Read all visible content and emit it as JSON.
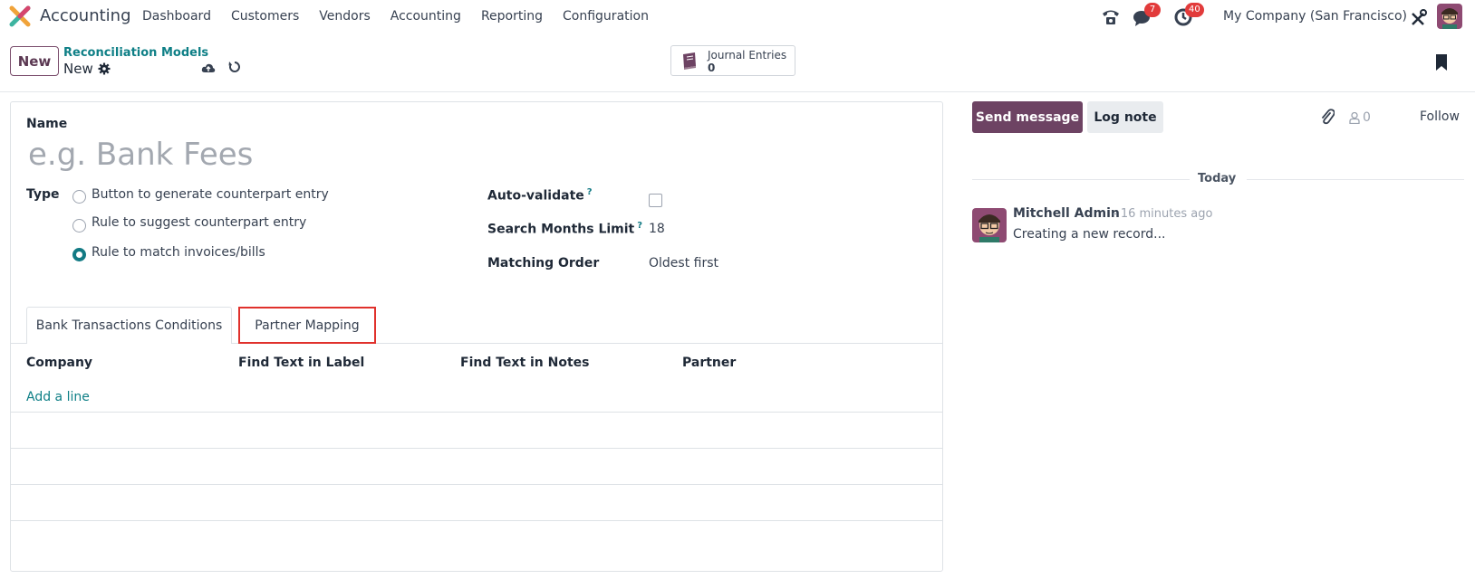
{
  "navbar": {
    "app_name": "Accounting",
    "menu": [
      "Dashboard",
      "Customers",
      "Vendors",
      "Accounting",
      "Reporting",
      "Configuration"
    ],
    "chat_badge": "7",
    "activity_badge": "40",
    "company": "My Company (San Francisco)"
  },
  "control_panel": {
    "new_label": "New",
    "breadcrumb_parent": "Reconciliation Models",
    "breadcrumb_current": "New",
    "smart_button": {
      "label": "Journal Entries",
      "value": "0"
    }
  },
  "form": {
    "name_label": "Name",
    "name_placeholder": "e.g. Bank Fees",
    "type_label": "Type",
    "type_options": [
      {
        "label": "Button to generate counterpart entry",
        "checked": false
      },
      {
        "label": "Rule to suggest counterpart entry",
        "checked": false
      },
      {
        "label": "Rule to match invoices/bills",
        "checked": true
      }
    ],
    "auto_validate_label": "Auto-validate",
    "auto_validate_checked": false,
    "search_months_label": "Search Months Limit",
    "search_months_value": "18",
    "matching_order_label": "Matching Order",
    "matching_order_value": "Oldest first",
    "help_mark": "?",
    "tabs": [
      "Bank Transactions Conditions",
      "Partner Mapping"
    ],
    "active_tab": "Partner Mapping",
    "columns": [
      "Company",
      "Find Text in Label",
      "Find Text in Notes",
      "Partner"
    ],
    "add_line_label": "Add a line"
  },
  "chatter": {
    "send_message_label": "Send message",
    "log_note_label": "Log note",
    "followers_count": "0",
    "follow_label": "Follow",
    "date_separator": "Today",
    "message": {
      "author": "Mitchell Admin",
      "time": "- 16 minutes ago",
      "body": "Creating a new record..."
    }
  },
  "colors": {
    "primary": "#6d4363",
    "link": "#0e7f86",
    "highlight_box": "#e0312c",
    "badge": "#e23b3b"
  }
}
